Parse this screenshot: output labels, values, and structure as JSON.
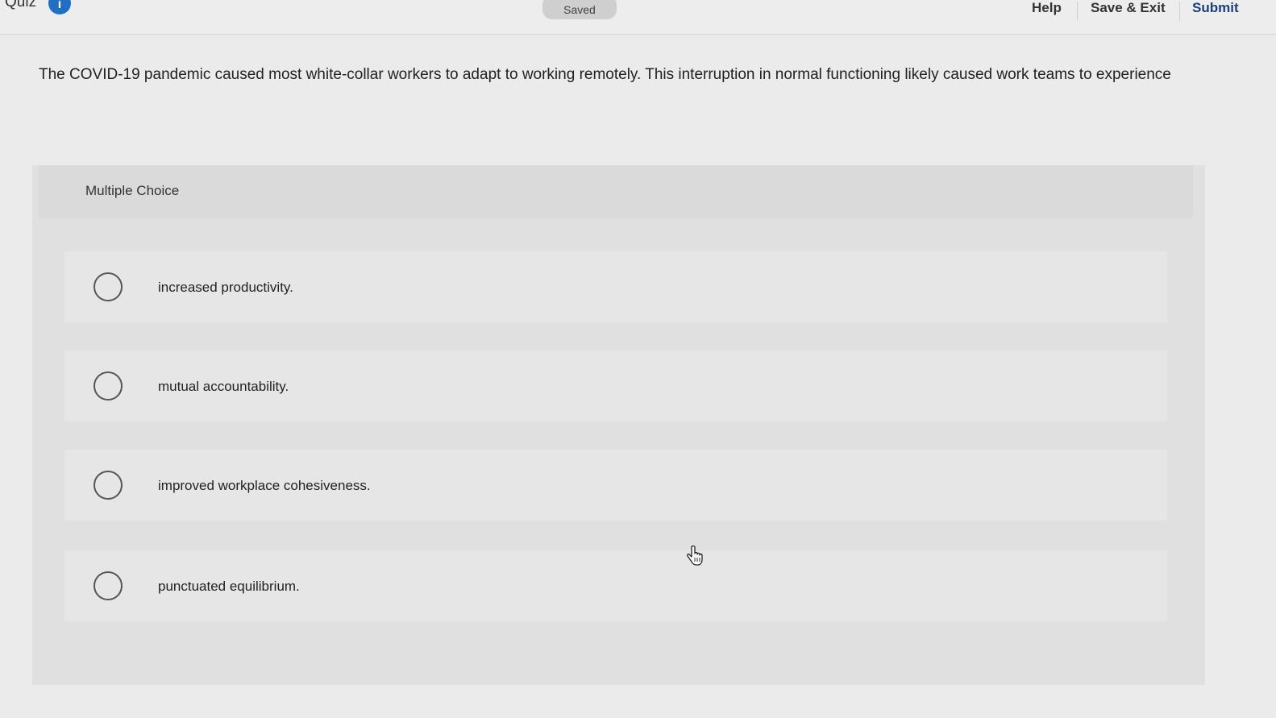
{
  "header": {
    "quiz_label": "Quiz",
    "info_glyph": "i",
    "saved_label": "Saved",
    "help_label": "Help",
    "save_exit_label": "Save & Exit",
    "submit_label": "Submit",
    "accent_color": "#1f6fc5"
  },
  "question": {
    "text": "The COVID-19 pandemic caused most white-collar workers to adapt to working remotely. This interruption in normal functioning likely caused work teams to experience"
  },
  "choices": {
    "title": "Multiple Choice",
    "options": [
      {
        "label": "increased productivity."
      },
      {
        "label": "mutual accountability."
      },
      {
        "label": "improved workplace cohesiveness."
      },
      {
        "label": "punctuated equilibrium."
      }
    ]
  },
  "icons": {
    "cursor": "hand-pointer-icon",
    "info": "info-icon",
    "radio": "radio-unselected-icon"
  }
}
